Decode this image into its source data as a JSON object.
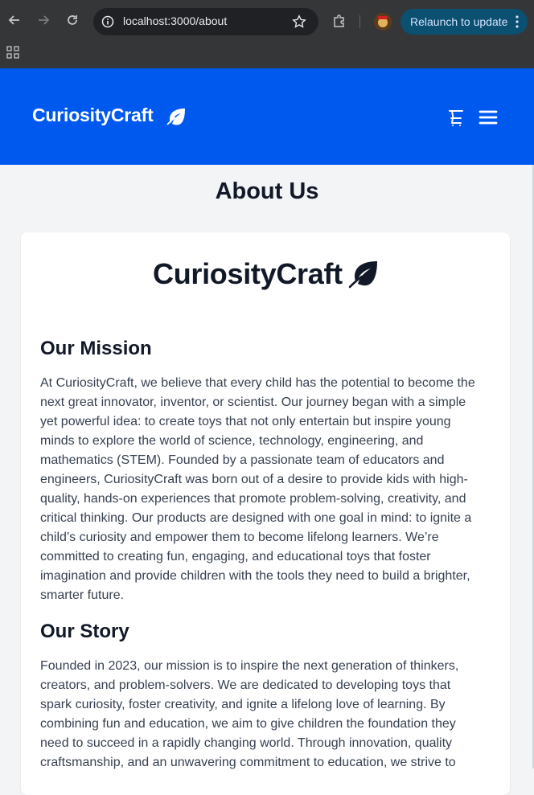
{
  "browser": {
    "url": "localhost:3000/about",
    "relaunch_label": "Relaunch to update",
    "icons": [
      "back-arrow-icon",
      "forward-arrow-icon",
      "reload-icon",
      "info-icon",
      "star-icon",
      "extensions-icon",
      "profile-avatar",
      "more-vert-icon",
      "apps-grid-icon"
    ]
  },
  "header": {
    "brand": "CuriosityCraft",
    "icons": [
      "leaf-icon",
      "cart-icon",
      "hamburger-menu-icon"
    ],
    "background": "#0059ef"
  },
  "page": {
    "title": "About Us"
  },
  "card": {
    "brand": "CuriosityCraft",
    "mission_heading": "Our Mission",
    "mission_lines": [
      "At CuriosityCraft, we believe that every child has the potential to become the",
      "next great innovator, inventor, or scientist. Our journey began with a simple",
      "yet powerful idea: to create toys that not only entertain but inspire young",
      "minds to explore the world of science, technology, engineering, and",
      "mathematics (STEM). Founded by a passionate team of educators and",
      "engineers, CuriosityCraft was born out of a desire to provide kids with high-",
      "quality, hands-on experiences that promote problem-solving, creativity, and",
      "critical thinking. Our products are designed with one goal in mind: to ignite a",
      "child’s curiosity and empower them to become lifelong learners. We’re",
      "committed to creating fun, engaging, and educational toys that foster",
      "imagination and provide children with the tools they need to build a brighter,",
      "smarter future."
    ],
    "story_heading": "Our Story",
    "story_lines": [
      "Founded in 2023, our mission is to inspire the next generation of thinkers,",
      "creators, and problem-solvers. We are dedicated to developing toys that",
      "spark curiosity, foster creativity, and ignite a lifelong love of learning. By",
      "combining fun and education, we aim to give children the foundation they",
      "need to succeed in a rapidly changing world. Through innovation, quality",
      "craftsmanship, and an unwavering commitment to education, we strive to"
    ]
  }
}
